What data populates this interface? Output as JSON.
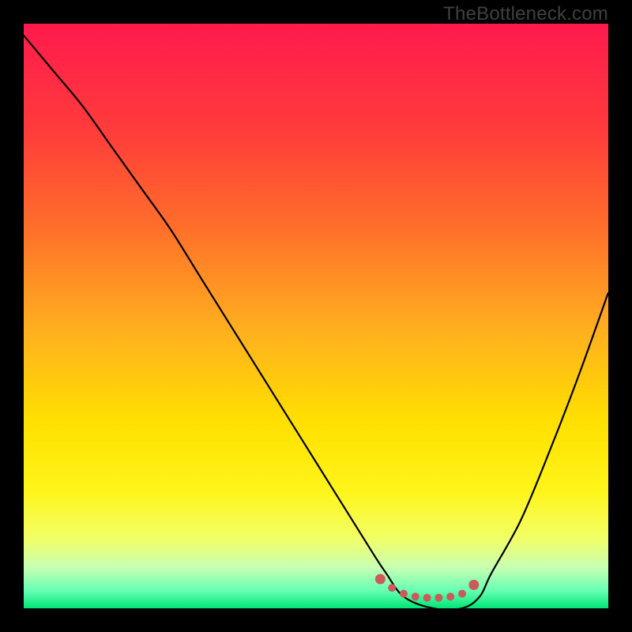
{
  "watermark": "TheBottleneck.com",
  "colors": {
    "frame": "#000000",
    "curve_stroke": "#000000",
    "marker_fill": "#cc5a5a",
    "gradient_stops": [
      {
        "offset": 0.0,
        "color": "#ff1a4d"
      },
      {
        "offset": 0.18,
        "color": "#ff3b3b"
      },
      {
        "offset": 0.35,
        "color": "#ff6f2a"
      },
      {
        "offset": 0.52,
        "color": "#ffae1f"
      },
      {
        "offset": 0.68,
        "color": "#ffe000"
      },
      {
        "offset": 0.8,
        "color": "#fff51a"
      },
      {
        "offset": 0.88,
        "color": "#f2ff66"
      },
      {
        "offset": 0.93,
        "color": "#c8ffb3"
      },
      {
        "offset": 0.97,
        "color": "#66ffb3"
      },
      {
        "offset": 1.0,
        "color": "#00e676"
      }
    ]
  },
  "chart_data": {
    "type": "line",
    "title": "",
    "xlabel": "",
    "ylabel": "",
    "xlim": [
      0,
      100
    ],
    "ylim": [
      0,
      100
    ],
    "series": [
      {
        "name": "bottleneck-curve",
        "x": [
          0,
          5,
          10,
          15,
          20,
          25,
          30,
          35,
          40,
          45,
          50,
          55,
          60,
          62,
          65,
          70,
          75,
          78,
          80,
          85,
          90,
          95,
          100
        ],
        "y": [
          98,
          92,
          86,
          79,
          72,
          65,
          57,
          49,
          41,
          33,
          25,
          17,
          9,
          6,
          2,
          0,
          0,
          2,
          6,
          15,
          27,
          40,
          54
        ]
      }
    ],
    "markers": {
      "name": "optimal-range",
      "x": [
        61,
        63,
        65,
        67,
        69,
        71,
        73,
        75,
        77
      ],
      "y": [
        5,
        3.5,
        2.5,
        2,
        1.8,
        1.8,
        2,
        2.5,
        4
      ]
    }
  }
}
